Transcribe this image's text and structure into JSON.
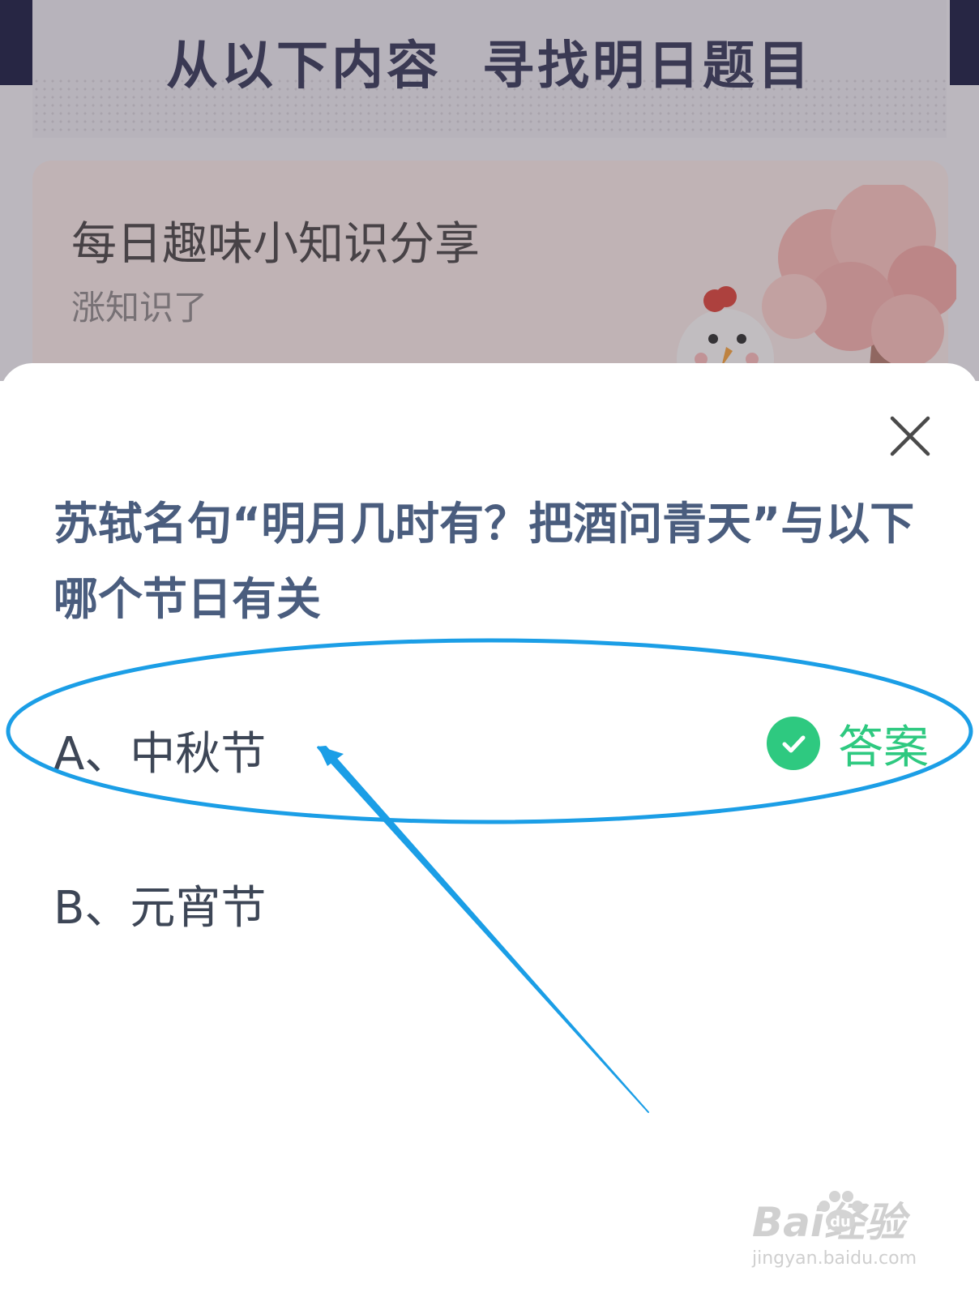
{
  "background": {
    "banner_title_left": "从以下内容",
    "banner_title_right": "寻找明日题目",
    "card_title": "每日趣味小知识分享",
    "card_subtitle": "涨知识了"
  },
  "sheet": {
    "question": "苏轼名句“明月几时有？把酒问青天”与以下哪个节日有关",
    "options": [
      {
        "label": "A、中秋节",
        "is_answer": true
      },
      {
        "label": "B、元宵节",
        "is_answer": false
      }
    ],
    "answer_label": "答案"
  },
  "watermark": {
    "brand": "Bai经验",
    "brand_du": "du",
    "url": "jingyan.baidu.com"
  },
  "colors": {
    "question": "#4a5d7e",
    "answer_green": "#2ec980",
    "annotation_blue": "#1b9ee6"
  }
}
